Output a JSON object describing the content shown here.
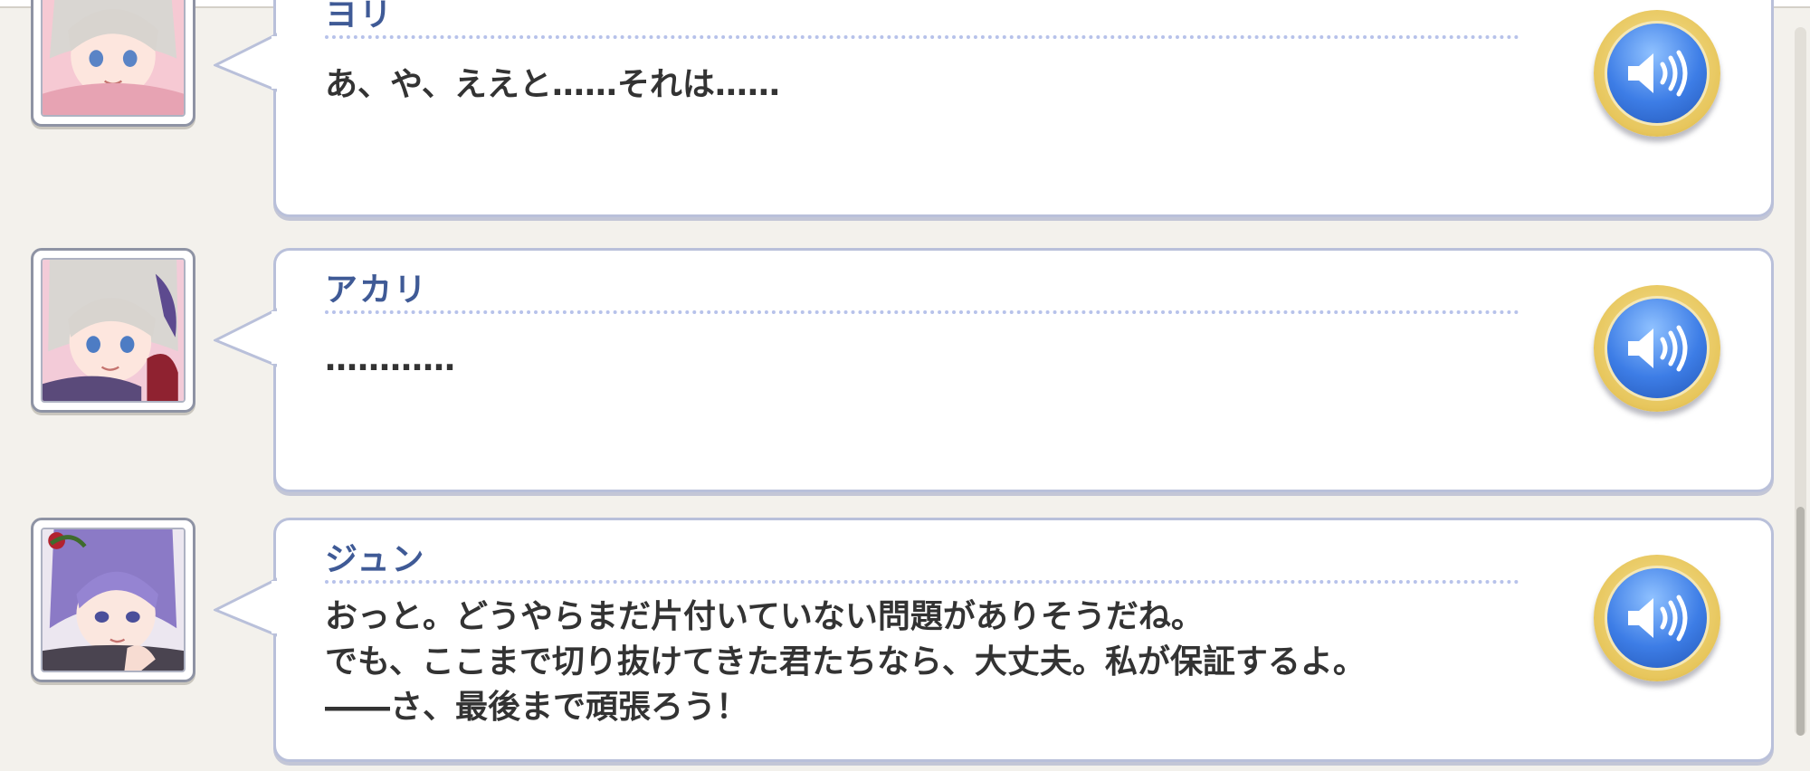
{
  "messages": [
    {
      "speaker": "ヨリ",
      "text": "あ、や、ええと……それは……"
    },
    {
      "speaker": "アカリ",
      "text": "…………"
    },
    {
      "speaker": "ジュン",
      "text": "おっと。どうやらまだ片付いていない問題がありそうだね。\nでも、ここまで切り抜けてきた君たちなら、大丈夫。私が保証するよ。\n――さ、最後まで頑張ろう！"
    }
  ],
  "icons": {
    "voice": "speaker-volume-icon",
    "avatar": "character-portrait"
  },
  "colors": {
    "background": "#f3f1ec",
    "speaker_name": "#3f5a96",
    "text": "#333333",
    "voice_button": "#3d7de6",
    "voice_rim": "#e7c65c"
  }
}
